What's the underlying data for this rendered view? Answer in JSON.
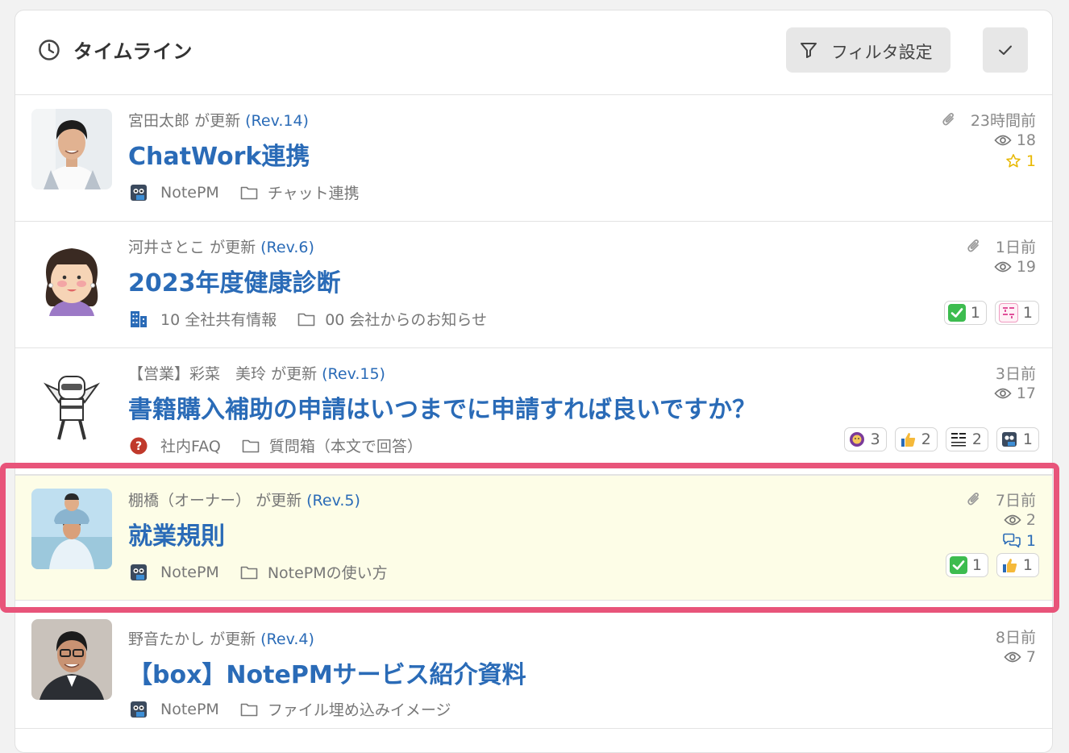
{
  "header": {
    "title": "タイムライン",
    "filter_label": "フィルタ設定"
  },
  "colors": {
    "link": "#2a6bb7",
    "highlight": "#e8547a",
    "star": "#e8b800"
  },
  "rows": [
    {
      "author": "宮田太郎",
      "action": "が更新",
      "rev": "(Rev.14)",
      "title": "ChatWork連携",
      "space": "NotePM",
      "folder": "チャット連携",
      "time": "23時間前",
      "views": "18",
      "stars": "1"
    },
    {
      "author": "河井さとこ",
      "action": "が更新",
      "rev": "(Rev.6)",
      "title": "2023年度健康診断",
      "space": "10 全社共有情報",
      "folder": "00 会社からのお知らせ",
      "time": "1日前",
      "views": "19",
      "reactions": [
        {
          "icon": "check-emoji",
          "count": "1"
        },
        {
          "icon": "ryoukai-desu-emoji",
          "count": "1"
        }
      ]
    },
    {
      "author": "【営業】彩菜　美玲",
      "action": "が更新",
      "rev": "(Rev.15)",
      "title": "書籍購入補助の申請はいつまでに申請すれば良いですか？",
      "space": "社内FAQ",
      "folder": "質問箱（本文で回答）",
      "time": "3日前",
      "views": "17",
      "reactions": [
        {
          "icon": "person-emoji",
          "count": "3"
        },
        {
          "icon": "thumbs-up-emoji",
          "count": "2"
        },
        {
          "icon": "kakunin-shimashita-emoji",
          "count": "2"
        },
        {
          "icon": "notepm-emoji",
          "count": "1"
        }
      ]
    },
    {
      "author": "棚橋（オーナー）",
      "action": "が更新",
      "rev": "(Rev.5)",
      "title": "就業規則",
      "space": "NotePM",
      "folder": "NotePMの使い方",
      "time": "7日前",
      "views": "2",
      "comments": "1",
      "reactions": [
        {
          "icon": "check-emoji",
          "count": "1"
        },
        {
          "icon": "thumbs-up-emoji",
          "count": "1"
        }
      ]
    },
    {
      "author": "野音たかし",
      "action": "が更新",
      "rev": "(Rev.4)",
      "title": "【box】NotePMサービス紹介資料",
      "space": "NotePM",
      "folder": "ファイル埋め込みイメージ",
      "time": "8日前",
      "views": "7"
    }
  ]
}
